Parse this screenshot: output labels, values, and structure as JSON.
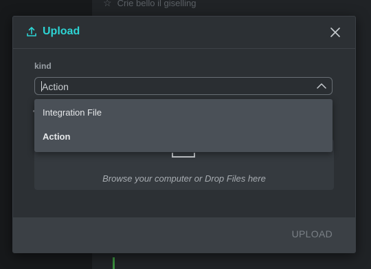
{
  "background": {
    "row_text": "Crie bello il giselling",
    "star_icon": "star-icon"
  },
  "modal": {
    "title": "Upload",
    "title_icon": "upload-icon",
    "close_icon": "close-icon",
    "accent_color": "#2dd4d4",
    "field": {
      "label": "kind",
      "value": "Action",
      "chevron_icon": "chevron-up-icon"
    },
    "dropdown": {
      "options": [
        "Integration File",
        "Action"
      ],
      "selected": "Action"
    },
    "dropzone": {
      "icon": "file-icon",
      "text": "Browse your computer or Drop Files here"
    },
    "footer": {
      "upload_label": "UPLOAD"
    }
  }
}
